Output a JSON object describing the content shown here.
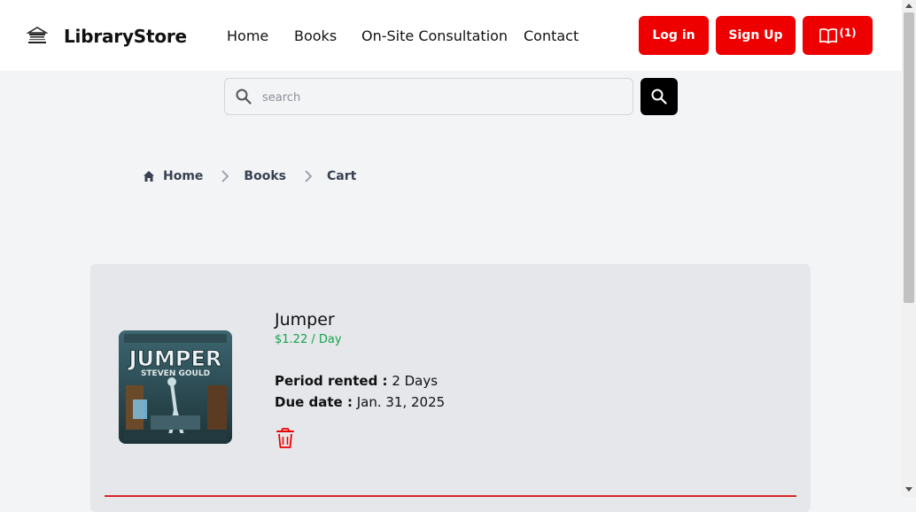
{
  "header": {
    "brand": "LibraryStore",
    "nav": [
      "Home",
      "Books",
      "On-Site Consultation",
      "Contact"
    ],
    "login_label": "Log in",
    "signup_label": "Sign Up",
    "cart_count": "(1)"
  },
  "search": {
    "placeholder": "search",
    "value": ""
  },
  "breadcrumb": [
    "Home",
    "Books",
    "Cart"
  ],
  "cart_item": {
    "title": "Jumper",
    "price": "$1.22 / Day",
    "period_label": "Period rented :",
    "period_value": "2 Days",
    "due_label": "Due date :",
    "due_value": "Jan. 31, 2025",
    "cover_title": "JUMPER",
    "cover_author": "STEVEN GOULD"
  },
  "colors": {
    "accent": "#ee0000",
    "price": "#16a34a",
    "panel": "#e5e7eb",
    "background": "#f3f4f6"
  }
}
